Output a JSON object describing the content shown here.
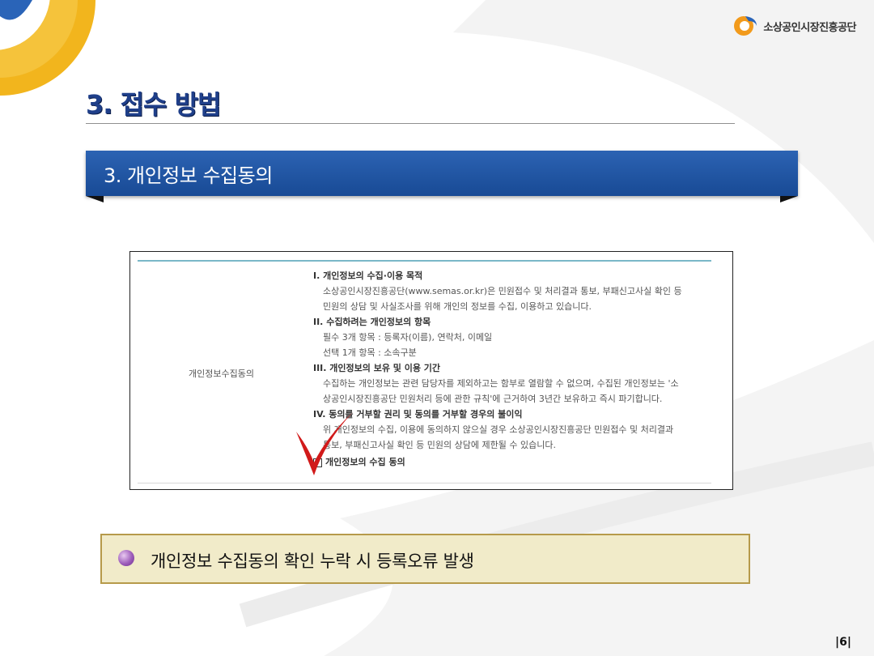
{
  "logo": {
    "text": "소상공인시장진흥공단"
  },
  "page": {
    "title": "3. 접수 방법",
    "section": "3. 개인정보 수집동의",
    "number": "|6|"
  },
  "consent_form": {
    "row_label": "개인정보수집동의",
    "sections": [
      {
        "heading": "I. 개인정보의 수집·이용 목적",
        "lines": [
          "소상공인시장진흥공단(www.semas.or.kr)은 민원접수 및 처리결과 통보, 부패신고사실 확인 등",
          "민원의 상담 및 사실조사를 위해 개인의 정보를 수집, 이용하고 있습니다."
        ]
      },
      {
        "heading": "II. 수집하려는 개인정보의 항목",
        "lines": [
          "필수 3개 항목 : 등록자(이름), 연락처, 이메일",
          "선택 1개 항목 : 소속구분"
        ]
      },
      {
        "heading": "III. 개인정보의 보유 및 이용 기간",
        "lines": [
          "수집하는 개인정보는 관련 담당자를 제외하고는 함부로 열람할 수 없으며, 수집된 개인정보는 '소",
          "상공인시장진흥공단 민원처리 등에 관한 규칙'에 근거하여 3년간 보유하고 즉시 파기합니다."
        ]
      },
      {
        "heading": "IV. 동의를 거부할 권리 및 동의를 거부할 경우의 불이익",
        "lines": [
          "위 개인정보의 수집, 이용에 동의하지 않으실 경우 소상공인시장진흥공단 민원접수 및 처리결과",
          "통보, 부패신고사실 확인 등 민원의 상담에 제한될 수 있습니다."
        ]
      }
    ],
    "agree_label": "개인정보의 수집 동의"
  },
  "notice": {
    "text": "개인정보 수집동의 확인 누락 시 등록오류 발생"
  },
  "colors": {
    "title": "#1f3f8a",
    "banner": "#184a95",
    "check_mark": "#d11a1a",
    "notice_bg": "#f1ebc9",
    "notice_border": "#b69a4a",
    "bullet": "#9d5dba"
  }
}
